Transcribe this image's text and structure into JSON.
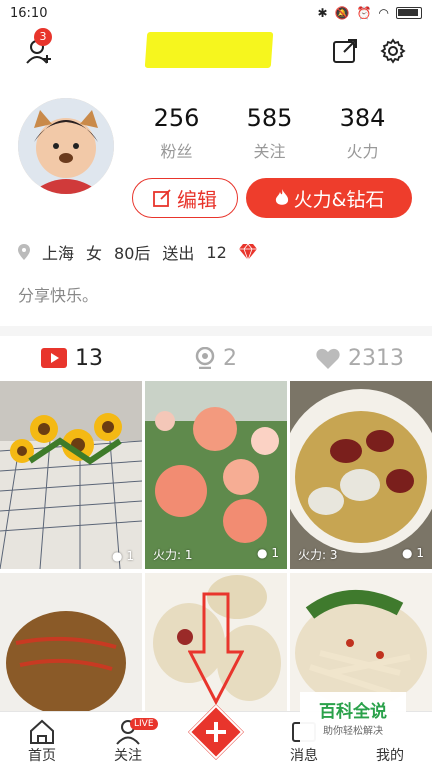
{
  "status_bar": {
    "time": "16:10"
  },
  "header": {
    "notification_count": "3"
  },
  "stats": [
    {
      "value": "256",
      "label": "粉丝"
    },
    {
      "value": "585",
      "label": "关注"
    },
    {
      "value": "384",
      "label": "火力"
    }
  ],
  "buttons": {
    "edit": "编辑",
    "fire_diamond": "火力&钻石"
  },
  "info": {
    "location": "上海",
    "gender": "女",
    "age": "80后",
    "gift_label": "送出",
    "gift_count": "12"
  },
  "bio": "分享快乐。",
  "tabs": [
    {
      "count": "13",
      "icon": "video-icon"
    },
    {
      "count": "2",
      "icon": "webcam-icon"
    },
    {
      "count": "2313",
      "icon": "heart-icon"
    }
  ],
  "grid": [
    {
      "fire": "",
      "comments": "1"
    },
    {
      "fire": "火力: 1",
      "comments": "1"
    },
    {
      "fire": "火力: 3",
      "comments": "1"
    }
  ],
  "tabbar": {
    "home": "首页",
    "follow": "关注",
    "live_badge": "LIVE",
    "messages": "消息",
    "mine": "我的"
  },
  "watermark": {
    "title": "百科全说",
    "subtitle": "助你轻松解决"
  },
  "colors": {
    "accent": "#e8352c",
    "highlight": "#f6f61e"
  }
}
